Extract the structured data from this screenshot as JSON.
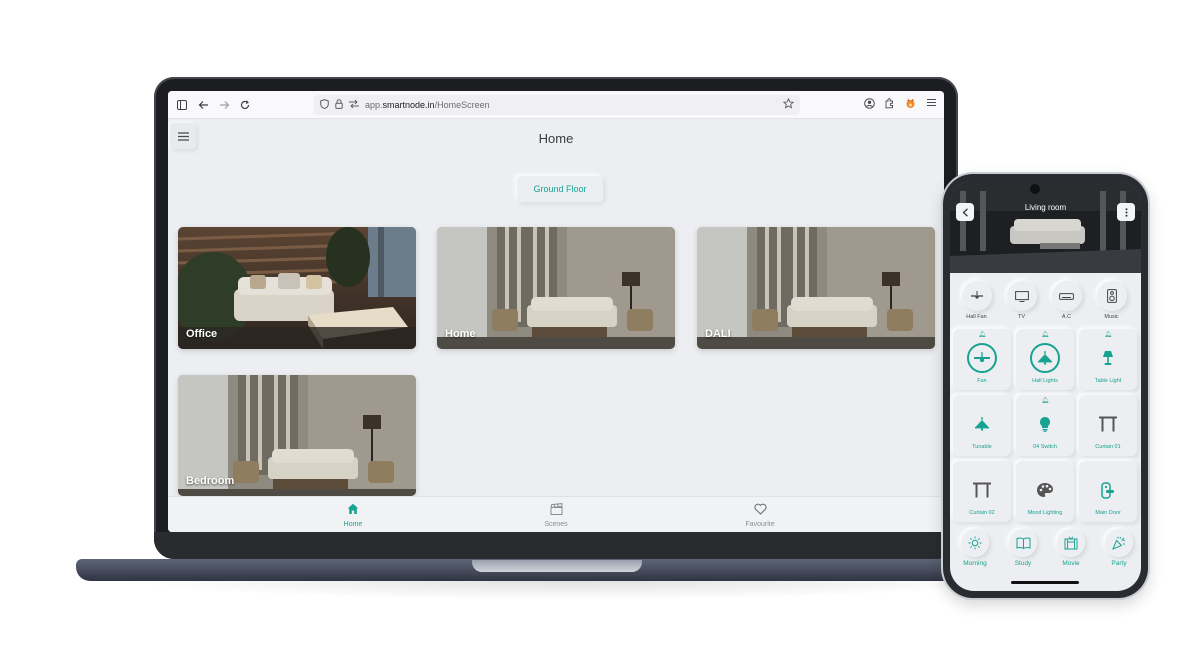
{
  "browser": {
    "url_prefix": "app.",
    "url_domain": "smartnode.in",
    "url_path": "/HomeScreen"
  },
  "app": {
    "title": "Home",
    "floor_button": "Ground Floor",
    "rooms": [
      {
        "label": "Office"
      },
      {
        "label": "Home"
      },
      {
        "label": "DALI"
      },
      {
        "label": "Bedroom"
      }
    ],
    "bottom_nav": [
      {
        "label": "Home",
        "icon": "home-icon",
        "active": true
      },
      {
        "label": "Scenes",
        "icon": "clapperboard-icon",
        "active": false
      },
      {
        "label": "Favourite",
        "icon": "heart-icon",
        "active": false
      }
    ]
  },
  "phone": {
    "title": "Living room",
    "top_devices": [
      {
        "label": "Hall Fan",
        "icon": "ceiling-fan-icon"
      },
      {
        "label": "TV",
        "icon": "tv-icon"
      },
      {
        "label": "A.C",
        "icon": "ac-icon"
      },
      {
        "label": "Music",
        "icon": "speaker-icon"
      }
    ],
    "tiles": [
      {
        "label": "Fan",
        "icon": "ceiling-fan-icon",
        "on": true,
        "alarm": true
      },
      {
        "label": "Hall Lights",
        "icon": "pendant-lamp-icon",
        "on": true,
        "alarm": true
      },
      {
        "label": "Table Light",
        "icon": "table-lamp-icon",
        "on": false,
        "alarm": true
      },
      {
        "label": "Tunable",
        "icon": "pendant-lamp-icon",
        "on": false,
        "alarm": false
      },
      {
        "label": "04 Switch",
        "icon": "bulb-icon",
        "on": false,
        "alarm": true
      },
      {
        "label": "Curtain 01",
        "icon": "curtain-icon",
        "on": false,
        "alarm": false
      },
      {
        "label": "Curtain 02",
        "icon": "curtain-icon",
        "on": false,
        "alarm": false
      },
      {
        "label": "Mood Lighting",
        "icon": "palette-icon",
        "on": false,
        "alarm": false
      },
      {
        "label": "Main Door",
        "icon": "door-lock-icon",
        "on": false,
        "alarm": false
      }
    ],
    "scenes": [
      {
        "label": "Morning",
        "icon": "sun-icon"
      },
      {
        "label": "Study",
        "icon": "book-icon"
      },
      {
        "label": "Movie",
        "icon": "cinema-icon"
      },
      {
        "label": "Party",
        "icon": "party-icon"
      }
    ]
  },
  "colors": {
    "accent": "#17a392",
    "background": "#eceef1",
    "laptop_bezel": "#1c1d20"
  }
}
